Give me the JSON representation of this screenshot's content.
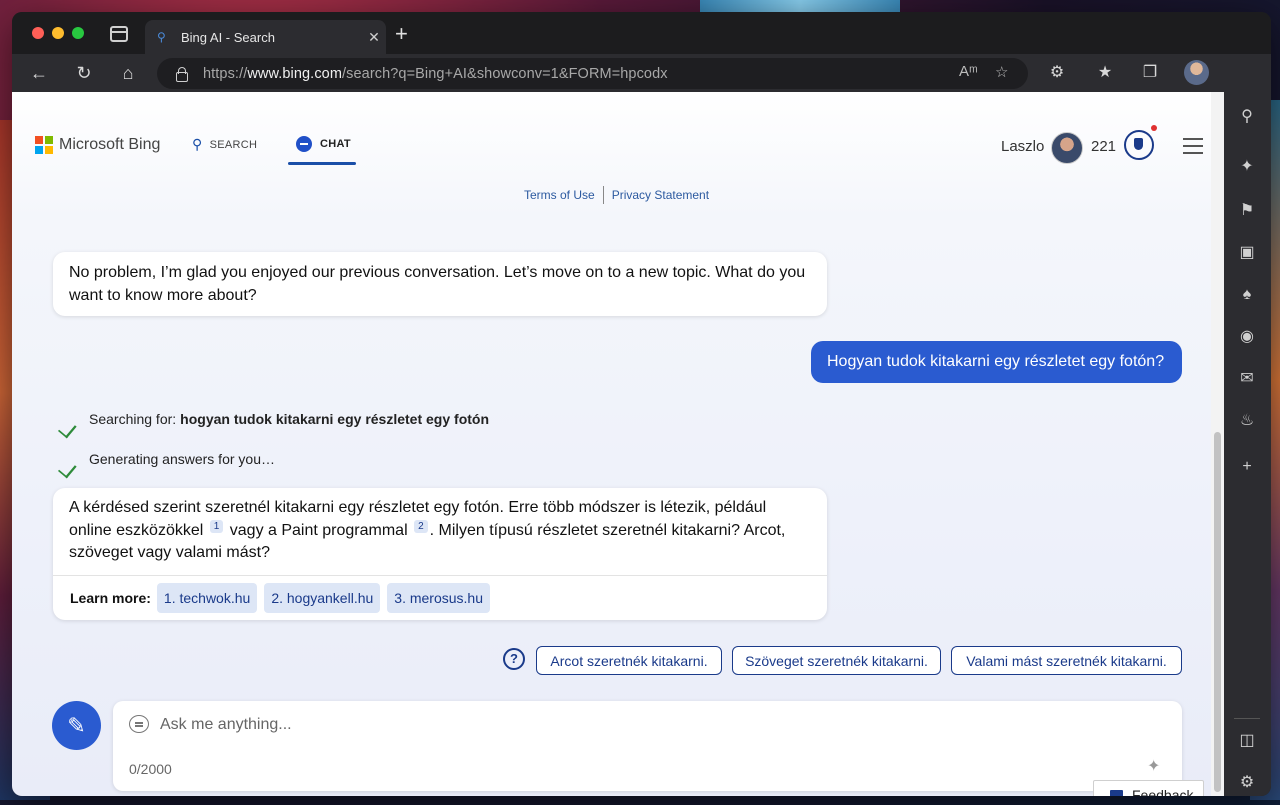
{
  "browser": {
    "tab_title": "Bing AI - Search",
    "tab_favicon": "search-icon",
    "url_prefix": "https://",
    "url_host": "www.bing.com",
    "url_path": "/search?q=Bing+AI&showconv=1&FORM=hpcodx"
  },
  "header": {
    "logo_text": "Microsoft Bing",
    "search_tab": "SEARCH",
    "chat_tab": "CHAT",
    "user_name": "Laszlo",
    "points": "221"
  },
  "legal": {
    "terms": "Terms of Use",
    "privacy": "Privacy Statement"
  },
  "conversation": {
    "bot_message_1": "No problem, I’m glad you enjoyed our previous conversation. Let’s move on to a new topic. What do you want to know more about?",
    "user_message": "Hogyan tudok kitakarni egy részletet egy fotón?",
    "status_searching_label": "Searching for:",
    "status_searching_query": "hogyan tudok kitakarni egy részletet egy fotón",
    "status_generating": "Generating answers for you…",
    "bot_message_2_part1": "A kérdésed szerint szeretnél kitakarni egy részletet egy fotón. Erre több módszer is létezik, például online eszközökkel",
    "ref1": "1",
    "bot_message_2_part2": "vagy a Paint programmal",
    "ref2": "2",
    "bot_message_2_part3": ". Milyen típusú részletet szeretnél kitakarni? Arcot, szöveget vagy valami mást?",
    "learn_more_label": "Learn more:",
    "sources": [
      "1. techwok.hu",
      "2. hogyankell.hu",
      "3. merosus.hu"
    ]
  },
  "suggestions": [
    "Arcot szeretnék kitakarni.",
    "Szöveget szeretnék kitakarni.",
    "Valami mást szeretnék kitakarni."
  ],
  "composer": {
    "placeholder": "Ask me anything...",
    "counter": "0/2000"
  },
  "feedback_label": "Feedback",
  "colors": {
    "accent": "#2a5bd0",
    "link": "#1a3a8a",
    "check": "#2e8b3a"
  }
}
